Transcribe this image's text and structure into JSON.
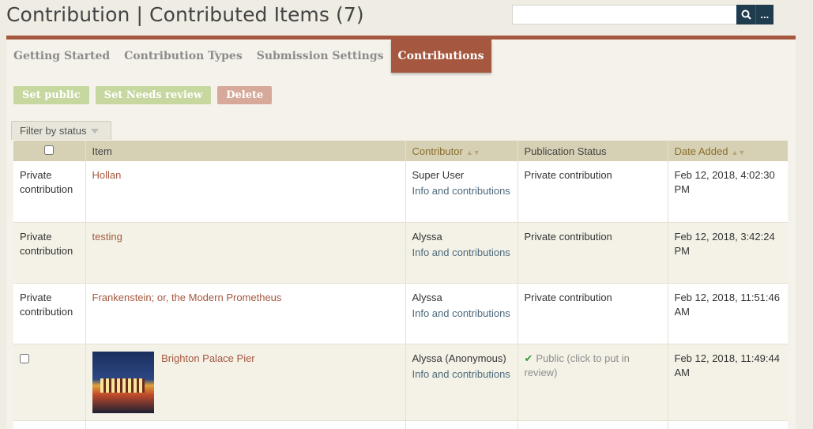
{
  "header": {
    "title": "Contribution | Contributed Items (7)",
    "search_placeholder": "",
    "search_label": "Q",
    "advanced_label": "..."
  },
  "tabs": [
    {
      "label": "Getting Started"
    },
    {
      "label": "Contribution Types"
    },
    {
      "label": "Submission Settings"
    },
    {
      "label": "Contributions",
      "active": true
    }
  ],
  "actions": {
    "set_public": "Set public",
    "set_needs_review": "Set Needs review",
    "delete": "Delete"
  },
  "filter": {
    "label": "Filter by status"
  },
  "table": {
    "headers": {
      "item": "Item",
      "contributor": "Contributor",
      "publication_status": "Publication Status",
      "date_added": "Date Added"
    },
    "rows": [
      {
        "select": "Private contribution",
        "item": "Hollan",
        "contributor": "Super User",
        "contributor_link": "Info and contributions",
        "status": "Private contribution",
        "date": "Feb 12, 2018, 4:02:30 PM"
      },
      {
        "select": "Private contribution",
        "item": "testing",
        "contributor": "Alyssa",
        "contributor_link": "Info and contributions",
        "status": "Private contribution",
        "date": "Feb 12, 2018, 3:42:24 PM"
      },
      {
        "select": "Private contribution",
        "item": "Frankenstein; or, the Modern Prometheus",
        "contributor": "Alyssa",
        "contributor_link": "Info and contributions",
        "status": "Private contribution",
        "date": "Feb 12, 2018, 11:51:46 AM"
      },
      {
        "select": "",
        "item": "Brighton Palace Pier",
        "contributor": "Alyssa (Anonymous)",
        "contributor_link": "Info and contributions",
        "status": "Public (click to put in review)",
        "date": "Feb 12, 2018, 11:49:44 AM"
      }
    ]
  },
  "colors": {
    "accent": "#a5573f",
    "header_bg": "#d6d0b4",
    "search_button": "#1f3c4f"
  }
}
